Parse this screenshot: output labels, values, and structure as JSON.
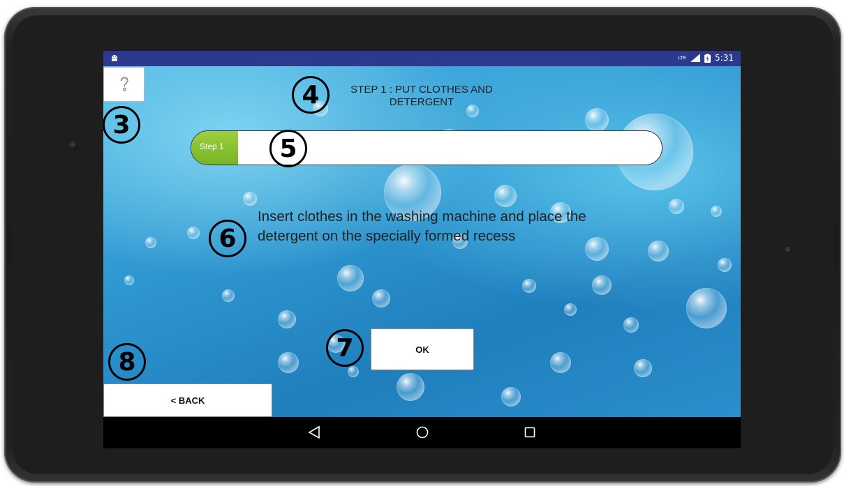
{
  "status_bar": {
    "network": "LTE",
    "time": "5:31"
  },
  "help_button": {
    "icon": "question-mark-icon",
    "label": "?"
  },
  "step_title": "STEP 1 : PUT CLOTHES AND DETERGENT",
  "progress": {
    "label": "Step 1",
    "fraction": 0.1,
    "fill_color": "#8dc63f"
  },
  "instruction": "Insert clothes in the washing machine and place the detergent on the specially formed recess",
  "ok_button": {
    "label": "OK"
  },
  "back_button": {
    "label": "< BACK"
  },
  "markers": [
    "3",
    "4",
    "5",
    "6",
    "7",
    "8"
  ],
  "nav_bar": {
    "back": "back-triangle-icon",
    "home": "home-circle-icon",
    "recents": "recents-square-icon"
  },
  "colors": {
    "status_bar": "#2b3a8f",
    "nav_bar": "#000000",
    "background": "#2a87c4"
  }
}
